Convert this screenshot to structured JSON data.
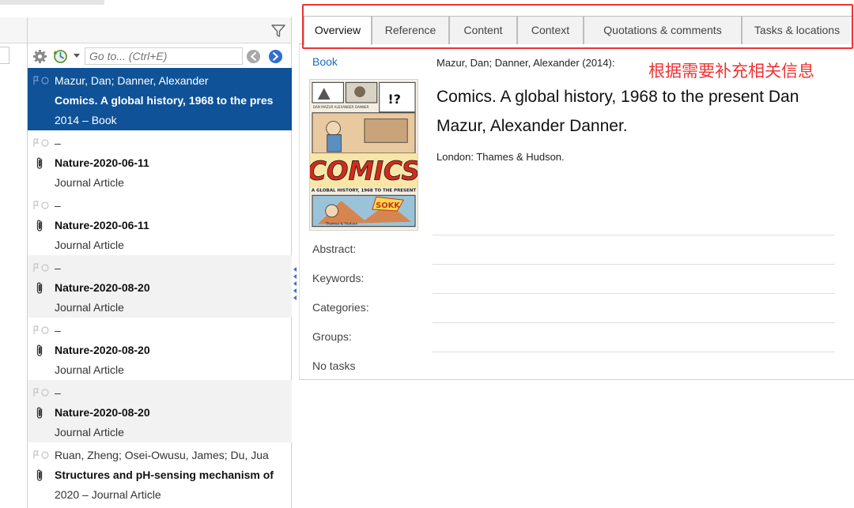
{
  "goto": {
    "placeholder": "Go to... (Ctrl+E)"
  },
  "list": {
    "items": [
      {
        "authors": "Mazur, Dan; Danner, Alexander",
        "title": "Comics. A global history, 1968 to the pres",
        "subtitle": "2014 – Book",
        "attachment": false
      },
      {
        "authors": "–",
        "title": "Nature-2020-06-11",
        "subtitle": "Journal Article",
        "attachment": true
      },
      {
        "authors": "–",
        "title": "Nature-2020-06-11",
        "subtitle": "Journal Article",
        "attachment": true
      },
      {
        "authors": "–",
        "title": "Nature-2020-08-20",
        "subtitle": "Journal Article",
        "attachment": true
      },
      {
        "authors": "–",
        "title": "Nature-2020-08-20",
        "subtitle": "Journal Article",
        "attachment": true
      },
      {
        "authors": "–",
        "title": "Nature-2020-08-20",
        "subtitle": "Journal Article",
        "attachment": true
      },
      {
        "authors": "Ruan, Zheng; Osei-Owusu, James; Du, Jua",
        "title": "Structures and pH-sensing mechanism of",
        "subtitle": "2020 – Journal Article",
        "attachment": true
      }
    ]
  },
  "tabs": [
    {
      "label": "Overview",
      "active": true
    },
    {
      "label": "Reference"
    },
    {
      "label": "Content"
    },
    {
      "label": "Context"
    },
    {
      "label": "Quotations & comments"
    },
    {
      "label": "Tasks & locations"
    }
  ],
  "detail": {
    "type": "Book",
    "authors_line": "Mazur, Dan; Danner, Alexander (2014):",
    "title": "Comics. A global history, 1968 to the present  Dan Mazur, Alexander Danner.",
    "publisher": "London: Thames & Hudson.",
    "fields": {
      "abstract": "Abstract:",
      "keywords": "Keywords:",
      "categories": "Categories:",
      "groups": "Groups:",
      "tasks": "No tasks"
    }
  },
  "annotation": {
    "note": "根据需要补充相关信息",
    "color": "#e33333"
  },
  "cover": {
    "authors": "DAN MAZUR  ALEXANDER DANNER",
    "word": "COMICS",
    "subtitle": "A GLOBAL HISTORY, 1968 TO THE PRESENT",
    "sound": "SOKK",
    "shout": "!?",
    "publisher": "Thames & Hudson"
  },
  "colors": {
    "selection": "#0f5298",
    "link": "#1a6cc4",
    "annotation": "#e33333"
  }
}
